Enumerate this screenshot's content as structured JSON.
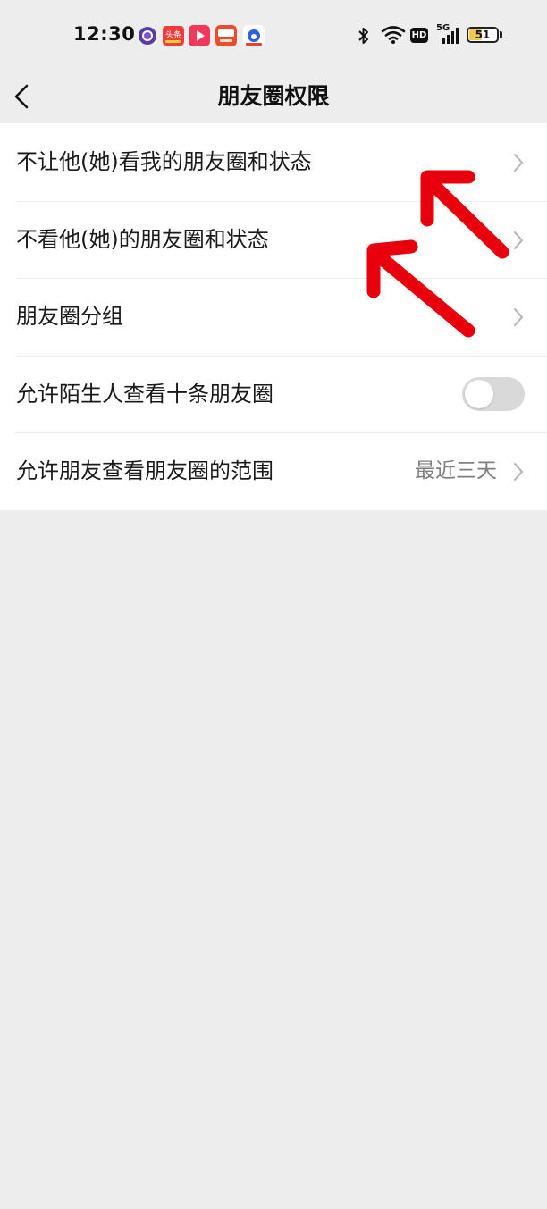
{
  "status_bar": {
    "time": "12:30",
    "network": "5G",
    "hd_label": "HD",
    "battery_level": "51",
    "battery_fraction": 0.51,
    "icons": [
      "bluetooth-icon",
      "wifi-icon",
      "hd-icon",
      "signal-5g-icon",
      "battery-icon"
    ],
    "app_icons": [
      "purple-app-icon",
      "toutiao-app-icon",
      "video-app-icon",
      "red-app-icon",
      "baidu-app-icon"
    ],
    "app_icon_labels": {
      "toutiao": "头条"
    }
  },
  "nav": {
    "title": "朋友圈权限",
    "back_icon": "chevron-left-icon"
  },
  "settings": [
    {
      "label": "不让他(她)看我的朋友圈和状态",
      "control": "chevron"
    },
    {
      "label": "不看他(她)的朋友圈和状态",
      "control": "chevron"
    },
    {
      "label": "朋友圈分组",
      "control": "chevron"
    },
    {
      "label": "允许陌生人查看十条朋友圈",
      "control": "toggle",
      "toggle_on": false
    },
    {
      "label": "允许朋友查看朋友圈的范围",
      "control": "chevron",
      "value": "最近三天"
    }
  ],
  "colors": {
    "background": "#ededed",
    "list_background": "#ffffff",
    "toggle_off": "#d9d9d9",
    "annotation_arrow": "#e8000d",
    "battery_fill": "#f2c94c"
  }
}
